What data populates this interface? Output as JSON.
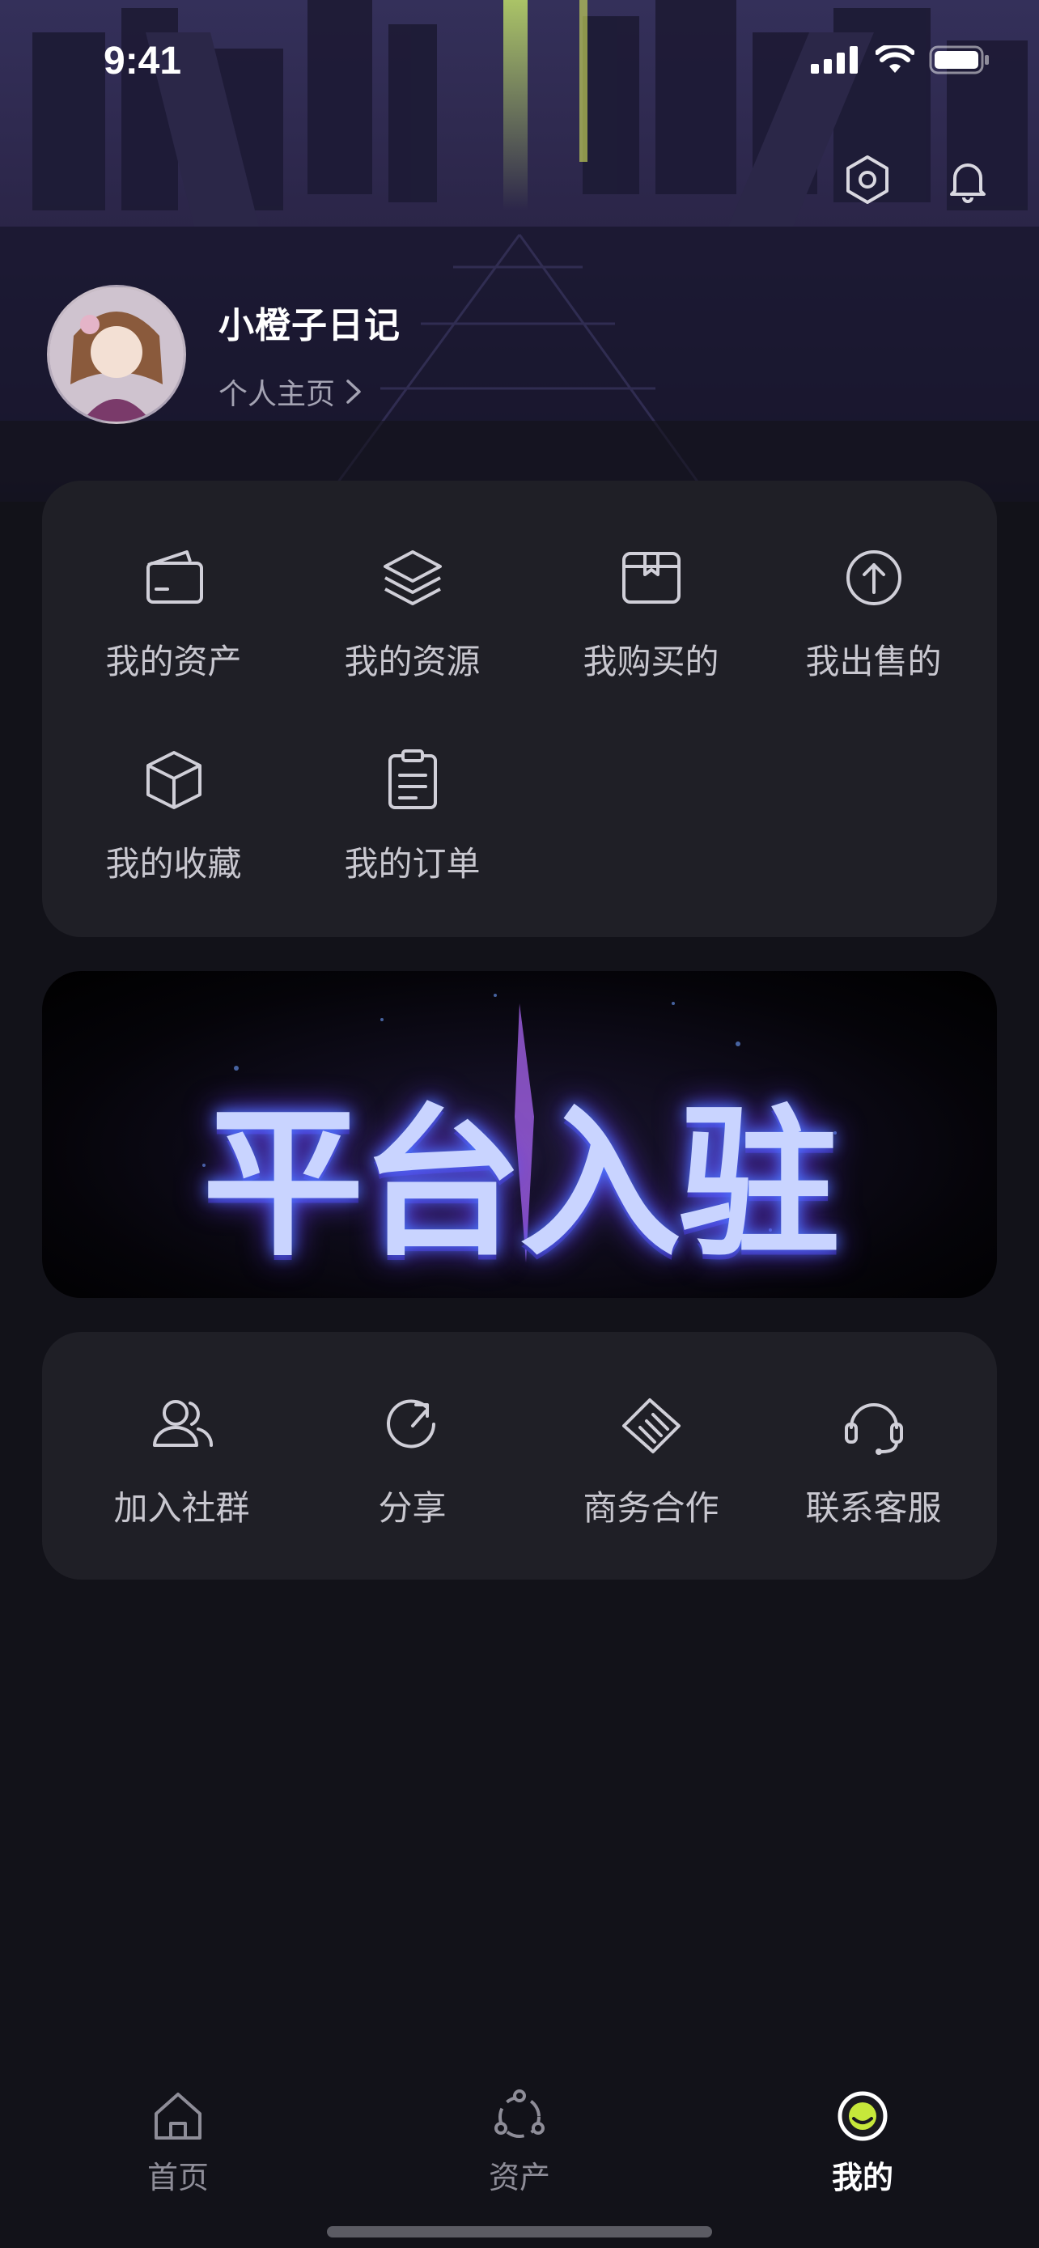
{
  "status_bar": {
    "time": "9:41"
  },
  "profile": {
    "nickname": "小橙子日记",
    "homepage_link": "个人主页"
  },
  "menu_primary": [
    {
      "label": "我的资产",
      "icon": "wallet-icon"
    },
    {
      "label": "我的资源",
      "icon": "layers-icon"
    },
    {
      "label": "我购买的",
      "icon": "box-icon"
    },
    {
      "label": "我出售的",
      "icon": "upload-circle-icon"
    },
    {
      "label": "我的收藏",
      "icon": "cube-icon"
    },
    {
      "label": "我的订单",
      "icon": "clipboard-icon"
    }
  ],
  "banner": {
    "title": "平台入驻"
  },
  "menu_secondary": [
    {
      "label": "加入社群",
      "icon": "group-icon"
    },
    {
      "label": "分享",
      "icon": "share-refresh-icon"
    },
    {
      "label": "商务合作",
      "icon": "handshake-icon"
    },
    {
      "label": "联系客服",
      "icon": "headset-icon"
    }
  ],
  "tab_bar": [
    {
      "label": "首页",
      "icon": "home-icon",
      "active": false
    },
    {
      "label": "资产",
      "icon": "assets-icon",
      "active": false
    },
    {
      "label": "我的",
      "icon": "profile-icon",
      "active": true
    }
  ],
  "colors": {
    "background": "#121219",
    "card": "#1f1f26",
    "accent": "#c6e83a"
  }
}
